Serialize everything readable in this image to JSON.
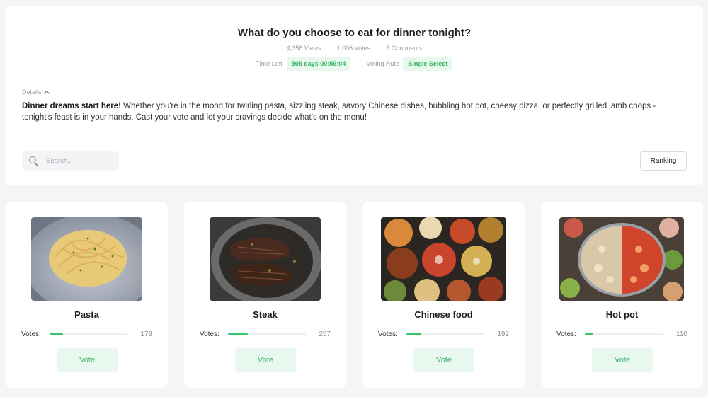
{
  "poll": {
    "title": "What do you choose to eat for dinner tonight?",
    "views": "4,356 Views",
    "votes_total": "1,006 Votes",
    "comments": "3 Comments",
    "time_left_label": "Time Left",
    "time_left_value": "505 days 00:59:04",
    "voting_rule_label": "Voting Rule",
    "voting_rule_value": "Single Select",
    "details_label": "Details",
    "description_lead": "Dinner dreams start here!",
    "description_body": " Whether you're in the mood for twirling pasta, sizzling steak, savory Chinese dishes, bubbling hot pot, cheesy pizza, or perfectly grilled lamb chops - tonight's feast is in your hands. Cast your vote and let your cravings decide what's on the menu!"
  },
  "toolbar": {
    "search_placeholder": "Search...",
    "ranking_label": "Ranking"
  },
  "options": [
    {
      "name": "Pasta",
      "votes_label": "Votes:",
      "votes": "173",
      "share": 0.172,
      "vote_label": "Vote"
    },
    {
      "name": "Steak",
      "votes_label": "Votes:",
      "votes": "257",
      "share": 0.255,
      "vote_label": "Vote"
    },
    {
      "name": "Chinese food",
      "votes_label": "Votes:",
      "votes": "192",
      "share": 0.191,
      "vote_label": "Vote"
    },
    {
      "name": "Hot pot",
      "votes_label": "Votes:",
      "votes": "110",
      "share": 0.109,
      "vote_label": "Vote"
    }
  ],
  "colors": {
    "accent_green": "#35c56a",
    "pill_bg": "#e8f8ee",
    "page_bg": "#f4f5f7"
  }
}
